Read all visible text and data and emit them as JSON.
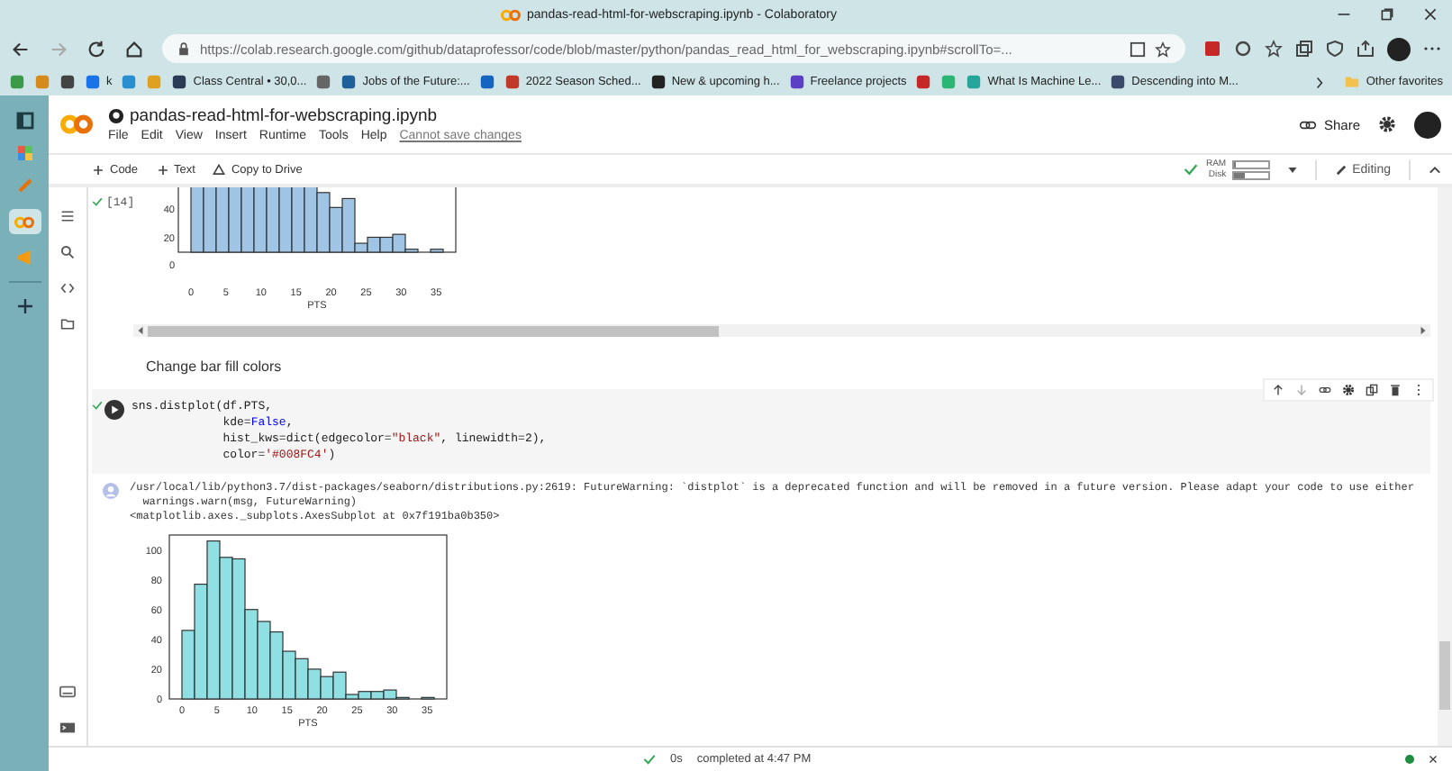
{
  "browser": {
    "title": "pandas-read-html-for-webscraping.ipynb - Colaboratory",
    "url": "https://colab.research.google.com/github/dataprofessor/code/blob/master/python/pandas_read_html_for_webscraping.ipynb#scrollTo=...",
    "bookmarks": [
      {
        "color": "#3a9a4a"
      },
      {
        "color": "#d68a1c"
      },
      {
        "color": "#444444"
      },
      {
        "label": "k",
        "color": "#1a73e8"
      },
      {
        "color": "#2a8fd0"
      },
      {
        "color": "#e0a020"
      },
      {
        "label": "Class Central • 30,0...",
        "color": "#2b3a55"
      },
      {
        "color": "#666666"
      },
      {
        "label": "Jobs of the Future:...",
        "color": "#1f5f9a"
      },
      {
        "color": "#1565c0"
      },
      {
        "label": "2022 Season Sched...",
        "color": "#c0392b"
      },
      {
        "label": "New & upcoming h...",
        "color": "#222222"
      },
      {
        "label": "Freelance projects",
        "color": "#5b3fc4"
      },
      {
        "color": "#c62828"
      },
      {
        "color": "#2bb673"
      },
      {
        "label": "What Is Machine Le...",
        "color": "#26a69a"
      },
      {
        "label": "Descending into M...",
        "color": "#3b4a6b"
      }
    ],
    "other_favorites": "Other favorites"
  },
  "notebook": {
    "title": "pandas-read-html-for-webscraping.ipynb",
    "menu": [
      "File",
      "Edit",
      "View",
      "Insert",
      "Runtime",
      "Tools",
      "Help"
    ],
    "save_notice": "Cannot save changes",
    "share": "Share",
    "toolbar": [
      "Code",
      "Text"
    ],
    "copy_to_drive": "Copy to Drive",
    "resources": [
      {
        "label": "RAM",
        "level": 0.05
      },
      {
        "label": "Disk",
        "level": 0.35
      }
    ],
    "mode": "Editing"
  },
  "cells": [
    {
      "kind": "output",
      "exec_count": "[14]",
      "plot": {
        "yticks": [
          "40",
          "20",
          "0"
        ],
        "xticks": [
          "0",
          "5",
          "10",
          "15",
          "20",
          "25",
          "30",
          "35"
        ],
        "xlabel": "PTS"
      }
    },
    {
      "kind": "text",
      "text": "Change bar fill colors"
    },
    {
      "kind": "code",
      "lines": [
        [
          {
            "kind": "plain",
            "t": "sns.distplot(df.PTS,"
          }
        ],
        [
          {
            "kind": "plain",
            "t": "             kde="
          },
          {
            "kind": "keyword",
            "t": "False"
          },
          {
            "kind": "plain",
            "t": ","
          }
        ],
        [
          {
            "kind": "plain",
            "t": "             hist_kws=dict(edgecolor="
          },
          {
            "kind": "string",
            "t": "\"black\""
          },
          {
            "kind": "plain",
            "t": ", linewidth=2),"
          }
        ],
        [
          {
            "kind": "plain",
            "t": "             color="
          },
          {
            "kind": "string",
            "t": "'#008FC4'"
          },
          {
            "kind": "plain",
            "t": ")"
          }
        ]
      ],
      "output": [
        "/usr/local/lib/python3.7/dist-packages/seaborn/distributions.py:2619: FutureWarning: `distplot` is a deprecated function and will be removed in a future version. Please adapt your code to use either",
        "  warnings.warn(msg, FutureWarning)",
        "<matplotlib.axes._subplots.AxesSubplot at 0x7f191ba0b350>"
      ],
      "chart_data": {
        "type": "bar",
        "xlabel": "PTS",
        "x": [
          0.9,
          2.7,
          4.5,
          6.3,
          8.1,
          9.9,
          11.7,
          13.5,
          15.3,
          17.1,
          18.9,
          20.7,
          22.5,
          24.3,
          26.1,
          27.9,
          29.7,
          31.5,
          33.3,
          35.1
        ],
        "series": [
          {
            "color": "#8fdfe3",
            "values": [
              46,
              77,
              106,
              95,
              94,
              60,
              52,
              45,
              32,
              27,
              20,
              15,
              18,
              3,
              5,
              5,
              6,
              1,
              0,
              1
            ]
          }
        ],
        "xlim": [
          -1.8,
          37.8
        ],
        "ylim": [
          0,
          110
        ],
        "xticks": [
          0,
          5,
          10,
          15,
          20,
          25,
          30,
          35
        ],
        "yticks": [
          0,
          20,
          40,
          60,
          80,
          100
        ]
      }
    }
  ],
  "status": {
    "duration": "0s",
    "text": "completed at 4:47 PM"
  }
}
